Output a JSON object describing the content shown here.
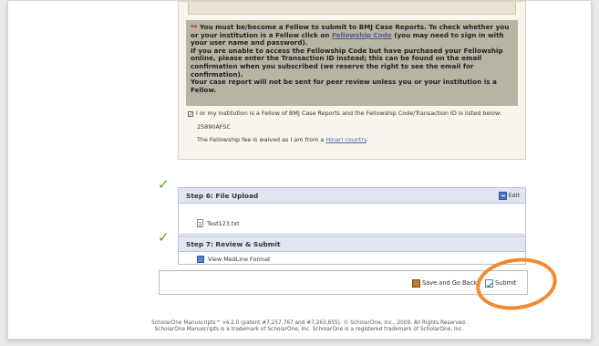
{
  "fee_section": {
    "notice": {
      "star": "**",
      "line1_pre": "You must be/become a Fellow to submit to BMJ Case Reports. To check whether you or your institution is a Fellow click on ",
      "line1_link": "Fellowship Code",
      "line1_post": " (you may need to sign in with your user name and password).",
      "line2": "If you are unable to access the Fellowship Code but have purchased your Fellowship online, please enter the Transaction ID instead; this can be found on the email confirmation when you subscribed (we reserve the right to see the email for confirmation).",
      "line3": "Your case report will not be sent for peer review unless you or your institution is a Fellow."
    },
    "agree_text": "I or my institution is a Fellow of BMJ Case Reports and the Fellowship Code/Transaction ID is listed below:",
    "code_value": "25890AFSC",
    "waiver_pre": "The Fellowship fee is waived as I am from a ",
    "waiver_link": "Hinari country",
    "waiver_post": "."
  },
  "step6": {
    "title": "Step 6: File Upload",
    "edit_label": "Edit",
    "file_name": "Test123.txt"
  },
  "step7": {
    "title": "Step 7: Review & Submit",
    "medline_label": "View MedLine Format"
  },
  "actions": {
    "save_label": "Save and Go Back",
    "submit_label": "Submit"
  },
  "footer": {
    "line1": "ScholarOne Manuscripts™ v4.2.0 (patent #7,257,767 and #7,263,655). © ScholarOne, Inc., 2009. All Rights Reserved.",
    "line2": "ScholarOne Manuscripts is a trademark of ScholarOne, Inc. ScholarOne is a registered trademark of ScholarOne, Inc."
  },
  "colors": {
    "step_check": "#55a332",
    "highlight": "#f28a2e",
    "step_header_bg": "#dfe6f1",
    "notice_bg": "#b8b4a4"
  },
  "icons": {
    "step_check": "checkmark-icon",
    "edit": "edit-icon",
    "file": "file-icon",
    "medline": "document-icon",
    "save": "save-icon",
    "submit": "submit-icon"
  }
}
